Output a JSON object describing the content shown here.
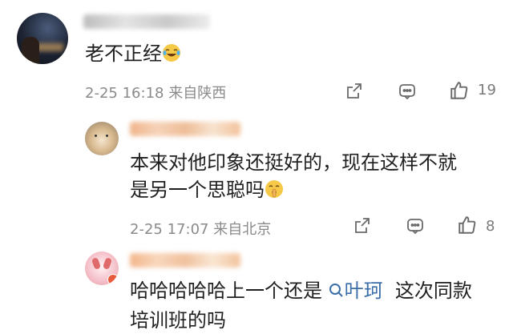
{
  "comments": [
    {
      "text": "老不正经",
      "emoji": "laughing-crying-emoji",
      "date": "2-25",
      "time": "16:18",
      "location": "来自陕西",
      "like_count": "19"
    },
    {
      "text_line1": "本来对他印象还挺好的，现在这样不就",
      "text_line2": "是另一个思聪吗",
      "emoji": "shushing-emoji",
      "date": "2-25",
      "time": "17:07",
      "location": "来自北京",
      "like_count": "8"
    },
    {
      "text_pre": "哈哈哈哈哈上一个还是",
      "mention": "叶珂",
      "text_post": "这次同款",
      "text_line2": "培训班的吗"
    }
  ],
  "icons": {
    "share": "share-icon",
    "comment": "comment-icon",
    "like": "thumbs-up-icon",
    "search": "search-icon"
  },
  "colors": {
    "meta_gray": "#8a8a8a",
    "mention_blue": "#3b6ea8",
    "divider": "#e8e8e8"
  }
}
